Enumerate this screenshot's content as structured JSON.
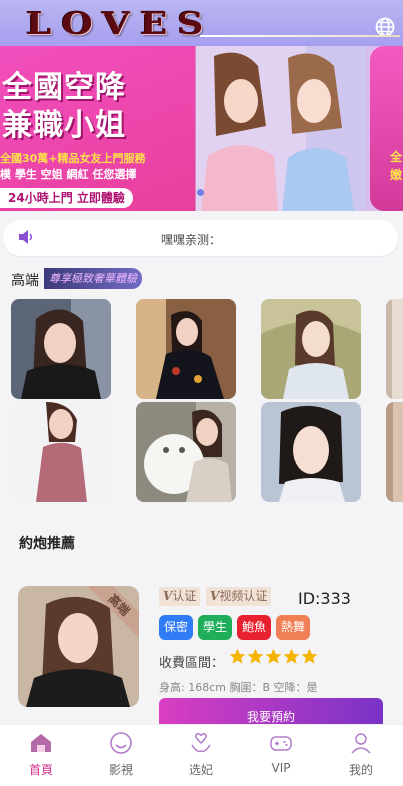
{
  "header": {
    "logo_text": "LOVES",
    "language_icon": "globe-icon"
  },
  "banner": {
    "headline_line1": "全國空降",
    "headline_line2": "兼職小姐",
    "promo_line1": "全國30萬+精品女友上門服務",
    "promo_line2": "模 學生 空姐 網紅 任您選擇",
    "promo_line3": "24小時上門 立即體驗",
    "right_peek": "全",
    "right_peek2": "嫩"
  },
  "notice": {
    "icon": "speaker-icon",
    "text": "嘿嘿亲测："
  },
  "highend": {
    "title": "高端",
    "tag": "尊享極致奢華體驗"
  },
  "recommend": {
    "title": "約炮推薦",
    "corner_label": "高端",
    "badge_verified": "认证",
    "badge_video": "视频认证",
    "id_text": "ID:333",
    "tags": [
      {
        "label": "保密",
        "color": "#2f7cf6"
      },
      {
        "label": "學生",
        "color": "#1fae5a"
      },
      {
        "label": "鮑魚",
        "color": "#e8212f"
      },
      {
        "label": "熱舞",
        "color": "#f07f55"
      }
    ],
    "fee_label": "收費區間：",
    "rating": 5,
    "stats": "身高: 168cm 胸圍：B 空降：是",
    "reserve_button": "我要預約"
  },
  "tabbar": [
    {
      "label": "首頁",
      "icon": "home-icon",
      "active": true
    },
    {
      "label": "影視",
      "icon": "smile-icon",
      "active": false
    },
    {
      "label": "选妃",
      "icon": "heart-hand-icon",
      "active": false
    },
    {
      "label": "VIP",
      "icon": "gamepad-icon",
      "active": false
    },
    {
      "label": "我的",
      "icon": "user-icon",
      "active": false
    }
  ],
  "colors": {
    "accent": "#d0308a",
    "header": "#aba6f0",
    "star": "#f5b400"
  }
}
